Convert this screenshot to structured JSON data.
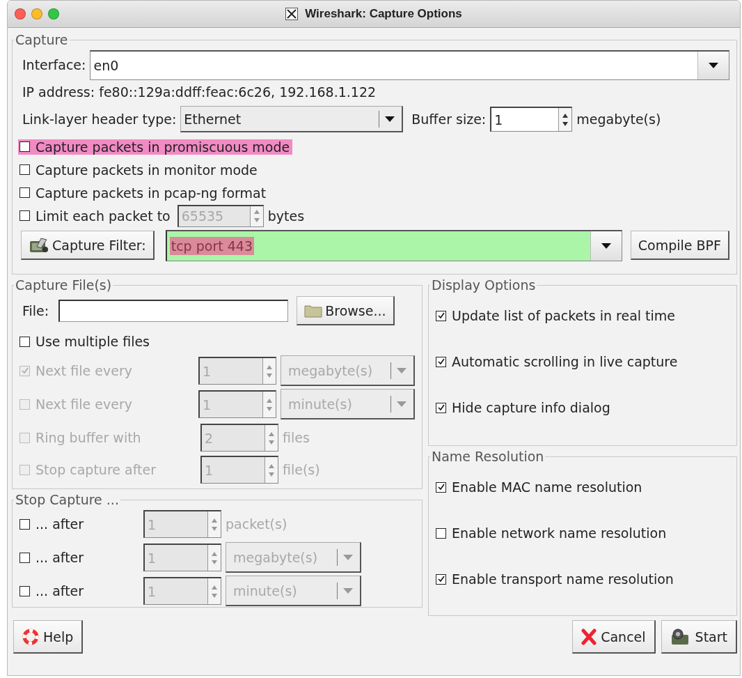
{
  "window": {
    "title": "Wireshark: Capture Options"
  },
  "capture": {
    "legend": "Capture",
    "interface": {
      "label": "Interface:",
      "value": "en0"
    },
    "ip_address": "IP address: fe80::129a:ddff:feac:6c26, 192.168.1.122",
    "link_layer": {
      "label": "Link-layer header type:",
      "value": "Ethernet"
    },
    "buffer": {
      "label": "Buffer size:",
      "value": "1",
      "unit": "megabyte(s)"
    },
    "options": [
      {
        "label": "Capture packets in promiscuous mode",
        "checked": false,
        "highlighted": true
      },
      {
        "label": "Capture packets in monitor mode",
        "checked": false,
        "highlighted": false
      },
      {
        "label": "Capture packets in pcap-ng format",
        "checked": false,
        "highlighted": false
      }
    ],
    "limit": {
      "label": "Limit each packet to",
      "checked": false,
      "value": "65535",
      "disabled": true,
      "unit": "bytes"
    },
    "filter": {
      "button": "Capture Filter:",
      "value": "tcp port 443",
      "highlighted": true,
      "compile_button": "Compile BPF"
    }
  },
  "capture_files": {
    "legend": "Capture File(s)",
    "file_label": "File:",
    "browse_button": "Browse...",
    "multiple": {
      "label": "Use multiple files",
      "checked": false
    },
    "rows": [
      {
        "kind": "dropdown",
        "label": "Next file every",
        "checked": true,
        "label_disabled": true,
        "disabled": true,
        "value": "1",
        "unit": "megabyte(s)"
      },
      {
        "kind": "dropdown",
        "label": "Next file every",
        "checked": false,
        "label_disabled": true,
        "disabled": true,
        "value": "1",
        "unit": "minute(s)"
      },
      {
        "kind": "text",
        "label": "Ring buffer with",
        "checked": false,
        "label_disabled": true,
        "disabled": true,
        "value": "2",
        "unit": "files"
      },
      {
        "kind": "text",
        "label": "Stop capture after",
        "checked": false,
        "label_disabled": true,
        "disabled": true,
        "value": "1",
        "unit": "file(s)"
      }
    ]
  },
  "stop_capture": {
    "legend": "Stop Capture ...",
    "rows": [
      {
        "kind": "text",
        "label": "... after",
        "checked": false,
        "label_disabled": false,
        "disabled": true,
        "value": "1",
        "unit": "packet(s)"
      },
      {
        "kind": "dropdown",
        "label": "... after",
        "checked": false,
        "label_disabled": false,
        "disabled": true,
        "value": "1",
        "unit": "megabyte(s)"
      },
      {
        "kind": "dropdown",
        "label": "... after",
        "checked": false,
        "label_disabled": false,
        "disabled": true,
        "value": "1",
        "unit": "minute(s)"
      }
    ]
  },
  "display_options": {
    "legend": "Display Options",
    "options": [
      {
        "label": "Update list of packets in real time",
        "checked": true
      },
      {
        "label": "Automatic scrolling in live capture",
        "checked": true
      },
      {
        "label": "Hide capture info dialog",
        "checked": true
      }
    ]
  },
  "name_resolution": {
    "legend": "Name Resolution",
    "options": [
      {
        "label": "Enable MAC name resolution",
        "checked": true
      },
      {
        "label": "Enable network name resolution",
        "checked": false
      },
      {
        "label": "Enable transport name resolution",
        "checked": true
      }
    ]
  },
  "buttons": {
    "help": "Help",
    "cancel": "Cancel",
    "start": "Start"
  }
}
